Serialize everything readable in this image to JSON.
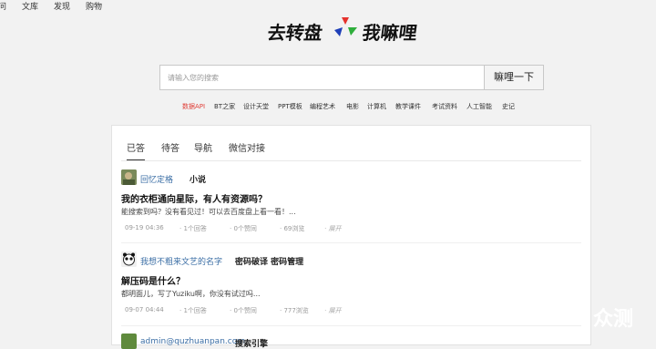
{
  "topnav": {
    "items": [
      "问",
      "文库",
      "发现",
      "购物"
    ]
  },
  "logo": {
    "left": "去转盘",
    "right": "我嘛哩"
  },
  "search": {
    "placeholder": "请输入您的搜索",
    "button": "嘛哩一下"
  },
  "categories": [
    "数据API",
    "BT之家",
    "设计天堂",
    "PPT模板",
    "编程艺术",
    "电影",
    "计算机",
    "教学课件",
    "考试资料",
    "人工智能",
    "史记"
  ],
  "tabs": [
    "已答",
    "待答",
    "导航",
    "微信对接"
  ],
  "questions": [
    {
      "user": "回忆定格",
      "tags": "小说",
      "title": "我的衣柜通向星际，有人有资源吗？",
      "desc": "能搜索到吗？没有看见过！可以去百度盘上看一看！...",
      "date": "09-19 04:36",
      "answers": "· 1个回答",
      "likes": "· 0个赞同",
      "views": "· 69浏览",
      "more": "· 展开"
    },
    {
      "user": "我想不粗来文艺的名字",
      "tags": "密码破译 密码管理",
      "title": "解压码是什么？",
      "desc": "都明面儿，写了Yuziku啊，你没有试过吗...",
      "date": "09-07 04:44",
      "answers": "· 1个回答",
      "likes": "· 0个赞同",
      "views": "· 777浏览",
      "more": "· 展开"
    },
    {
      "user": "admin@quzhuanpan.com",
      "tags": "搜索引擎"
    }
  ],
  "watermark": {
    "a": "新浪",
    "b": "众测"
  },
  "colors": {
    "accent_red": "#e0413a",
    "user_link": "#3b6ea5"
  }
}
